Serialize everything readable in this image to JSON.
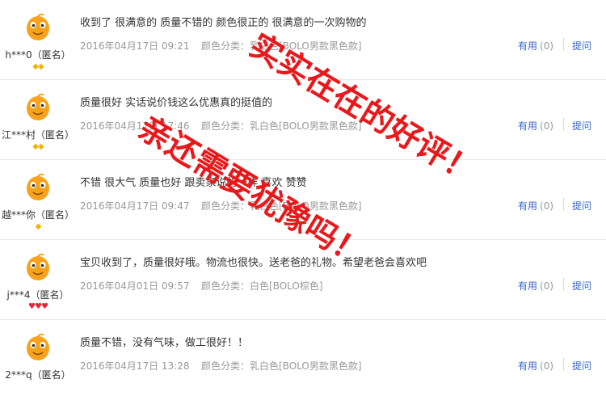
{
  "reviews": [
    {
      "user": "h***0（匿名）",
      "badge": "◆◆",
      "badge_type": "diamond",
      "content": "收到了 很满意的 质量不错的 颜色很正的 很满意的一次购物的",
      "date": "2016年04月17日 09:21",
      "spec": "颜色分类：乳白色[BOLO男款黑色款]",
      "useful_label": "有用",
      "useful_count": "(0)",
      "ask_label": "提问"
    },
    {
      "user": "江***村（匿名）",
      "badge": "◆◆",
      "badge_type": "diamond",
      "content": "质量很好 实话说价钱这么优惠真的挺值的",
      "date": "2016年04月17日 17:46",
      "spec": "颜色分类：乳白色[BOLO男款黑色款]",
      "useful_label": "有用",
      "useful_count": "(0)",
      "ask_label": "提问"
    },
    {
      "user": "越***你（匿名）",
      "badge": "◆",
      "badge_type": "diamond",
      "content": "不错 很大气 质量也好 跟卖家说的一样 喜欢 赞赞",
      "date": "2016年04月17日 09:47",
      "spec": "颜色分类：乳白色[BOLO男款黑色款]",
      "useful_label": "有用",
      "useful_count": "(0)",
      "ask_label": "提问"
    },
    {
      "user": "j***4（匿名）",
      "badge": "♥♥♥",
      "badge_type": "heart",
      "content": "宝贝收到了，质量很好哦。物流也很快。送老爸的礼物。希望老爸会喜欢吧",
      "date": "2016年04月01日 09:57",
      "spec": "颜色分类：白色[BOLO棕色]",
      "useful_label": "有用",
      "useful_count": "(0)",
      "ask_label": "提问"
    },
    {
      "user": "2***q（匿名）",
      "badge": "",
      "badge_type": "diamond",
      "content": "质量不错，没有气味，做工很好！！",
      "date": "2016年04月17日 13:28",
      "spec": "颜色分类：乳白色[BOLO男款黑色款]",
      "useful_label": "有用",
      "useful_count": "(0)",
      "ask_label": "提问"
    }
  ],
  "overlay": {
    "line1": "实实在在的好评！",
    "line2": "亲还需要犹豫吗！",
    "color": "#e8181b"
  },
  "colors": {
    "link": "#3366cc",
    "meta": "#999999",
    "divider": "#e8e8e8"
  }
}
